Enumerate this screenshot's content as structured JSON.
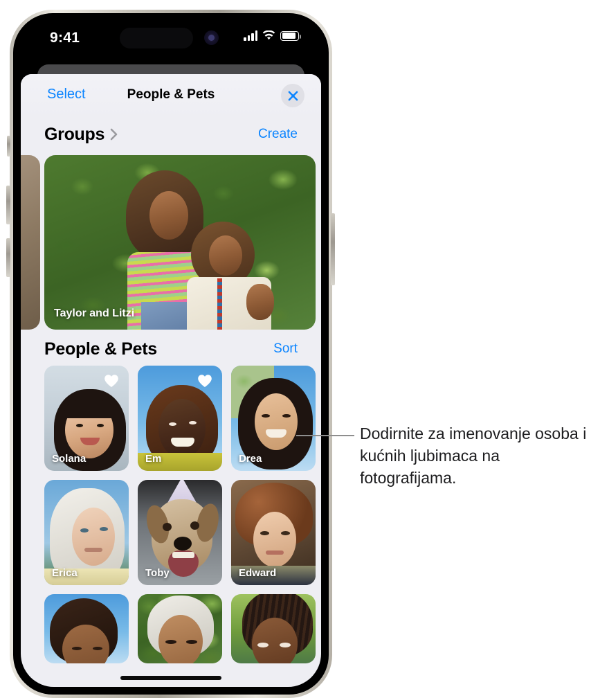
{
  "status_bar": {
    "time": "9:41",
    "icons": [
      "cellular-signal-icon",
      "wifi-icon",
      "battery-icon"
    ]
  },
  "nav": {
    "select_label": "Select",
    "title": "People & Pets",
    "close_icon": "close-icon"
  },
  "groups_section": {
    "title": "Groups",
    "chevron_icon": "chevron-right-icon",
    "action_label": "Create",
    "cards": [
      {
        "caption": "Taylor and Litzi"
      }
    ]
  },
  "people_section": {
    "title": "People & Pets",
    "action_label": "Sort",
    "rows": [
      [
        {
          "name": "Solana",
          "favorite": true,
          "heart_icon": "heart-icon"
        },
        {
          "name": "Em",
          "favorite": true,
          "heart_icon": "heart-icon"
        },
        {
          "name": "Drea",
          "favorite": false
        }
      ],
      [
        {
          "name": "Erica",
          "favorite": false
        },
        {
          "name": "Toby",
          "favorite": false
        },
        {
          "name": "Edward",
          "favorite": false
        }
      ],
      [
        {
          "name": "",
          "favorite": false
        },
        {
          "name": "",
          "favorite": false
        },
        {
          "name": "",
          "favorite": false
        }
      ]
    ]
  },
  "callout": {
    "text": "Dodirnite za imenovanje osoba i kućnih ljubimaca na fotografijama."
  },
  "colors": {
    "accent_blue": "#0a84ff",
    "sheet_background": "#eeeef3",
    "nav_background": "#f2f2f7",
    "close_button_background": "#e0e0e6",
    "callout_line": "#8e8e8e"
  }
}
